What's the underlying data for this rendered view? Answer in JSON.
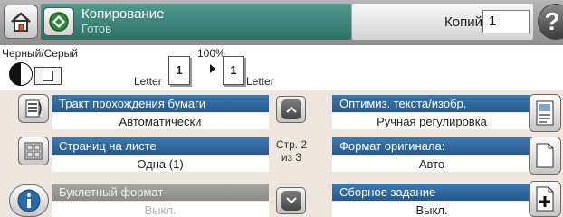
{
  "header": {
    "home_icon": "home-icon",
    "app_icon": "copy-icon",
    "title": "Копирование",
    "status": "Готов",
    "copies_label": "Копий:",
    "copies_value": "1",
    "help_label": "?"
  },
  "preview": {
    "color_mode": "Черный/Серый",
    "zoom": "100%",
    "source_paper": "Letter",
    "source_pages": "1",
    "dest_pages": "1",
    "dest_paper": "Letter"
  },
  "left_options": [
    {
      "label": "Тракт прохождения бумаги",
      "value": "Автоматически",
      "icon": "paper-path-icon",
      "enabled": true
    },
    {
      "label": "Страниц на листе",
      "value": "Одна (1)",
      "icon": "pages-per-sheet-icon",
      "enabled": true
    },
    {
      "label": "Буклетный формат",
      "value": "Выкл.",
      "icon": "info-icon",
      "enabled": false
    }
  ],
  "right_options": [
    {
      "label": "Оптимиз. текста/изобр.",
      "value": "Ручная регулировка",
      "icon": "optimize-icon",
      "enabled": true
    },
    {
      "label": "Формат оригинала:",
      "value": "Авто",
      "icon": "original-size-icon",
      "enabled": true
    },
    {
      "label": "Сборное задание",
      "value": "Выкл.",
      "icon": "job-build-icon",
      "enabled": true
    }
  ],
  "pagination": {
    "page_text": "Стр. 2",
    "of_text": "из 3"
  },
  "colors": {
    "header_accent": "#3b8275",
    "option_label": "#2f6aa0",
    "panel_bg": "#efe7dd"
  }
}
